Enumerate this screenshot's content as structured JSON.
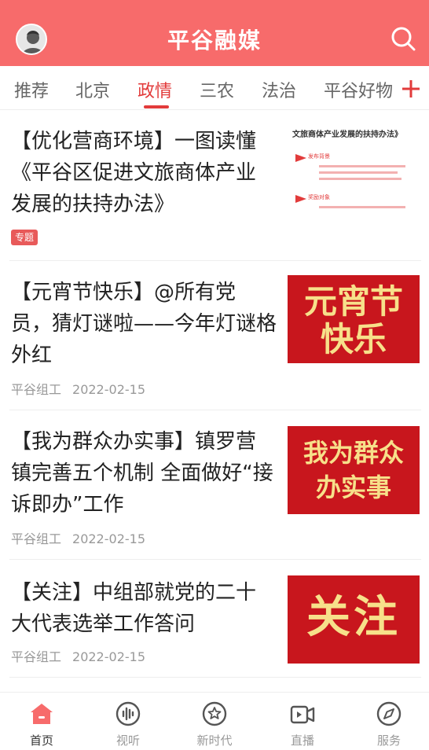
{
  "header": {
    "title": "平谷融媒"
  },
  "tabs": [
    {
      "label": "推荐"
    },
    {
      "label": "北京"
    },
    {
      "label": "政情",
      "active": true
    },
    {
      "label": "三农"
    },
    {
      "label": "法治"
    },
    {
      "label": "平谷好物"
    }
  ],
  "feed": [
    {
      "title_lines": [
        "【优化营商环境】一图读懂",
        "《平谷区促进文旅商体产业",
        "发展的扶持办法》"
      ],
      "tag": "专题",
      "thumb": {
        "heading": "文旅商体产业发展的扶持办法》",
        "section1": "发布背景",
        "section2": "奖励对象"
      }
    },
    {
      "title_lines": [
        "【元宵节快乐】@所有党",
        "员，猜灯谜啦——今年灯谜格",
        "外红"
      ],
      "source": "平谷组工",
      "date": "2022-02-15",
      "thumb": {
        "line1": "元宵节",
        "line2": "快乐"
      }
    },
    {
      "title_lines": [
        "【我为群众办实事】镇罗营",
        "镇完善五个机制 全面做好“接",
        "诉即办”工作"
      ],
      "source": "平谷组工",
      "date": "2022-02-15",
      "thumb": {
        "line1": "我为群众",
        "line2": "办实事"
      }
    },
    {
      "title_lines": [
        "【关注】中组部就党的二十",
        "大代表选举工作答问"
      ],
      "source": "平谷组工",
      "date": "2022-02-15",
      "thumb": {
        "line1": "关注"
      }
    }
  ],
  "bottom_nav": [
    {
      "label": "首页",
      "icon": "home-icon",
      "active": true
    },
    {
      "label": "视听",
      "icon": "audio-icon"
    },
    {
      "label": "新时代",
      "icon": "star-circle-icon"
    },
    {
      "label": "直播",
      "icon": "video-icon"
    },
    {
      "label": "服务",
      "icon": "compass-icon"
    }
  ],
  "colors": {
    "brand": "#f76b6b",
    "accent": "#e23b3b",
    "thumb_red": "#c8161d",
    "thumb_text": "#f7e08a"
  }
}
